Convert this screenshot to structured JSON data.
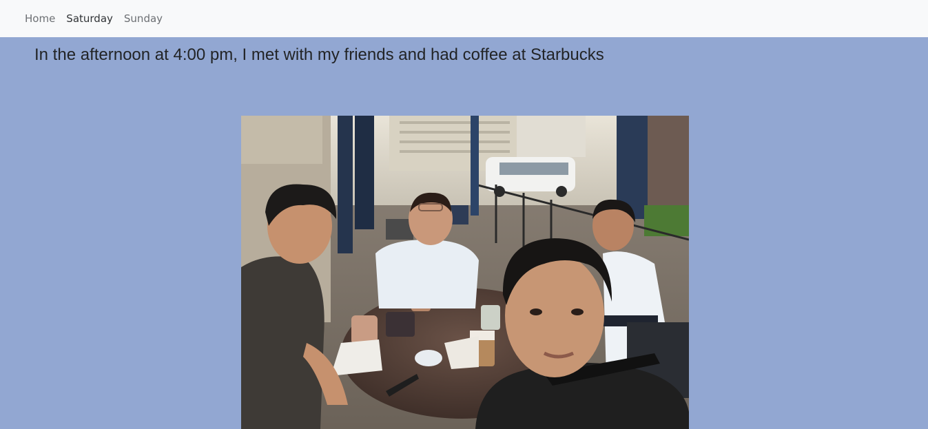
{
  "nav": {
    "items": [
      {
        "label": "Home",
        "active": false
      },
      {
        "label": "Saturday",
        "active": true
      },
      {
        "label": "Sunday",
        "active": false
      }
    ]
  },
  "main": {
    "heading": "In the afternoon at 4:00 pm, I met with my friends and had coffee at Starbucks"
  },
  "colors": {
    "page_background": "#92a7d2",
    "navbar_background": "#f8f9fa"
  },
  "photo": {
    "subject": "selfie of four friends at a round cafe table outdoors"
  }
}
